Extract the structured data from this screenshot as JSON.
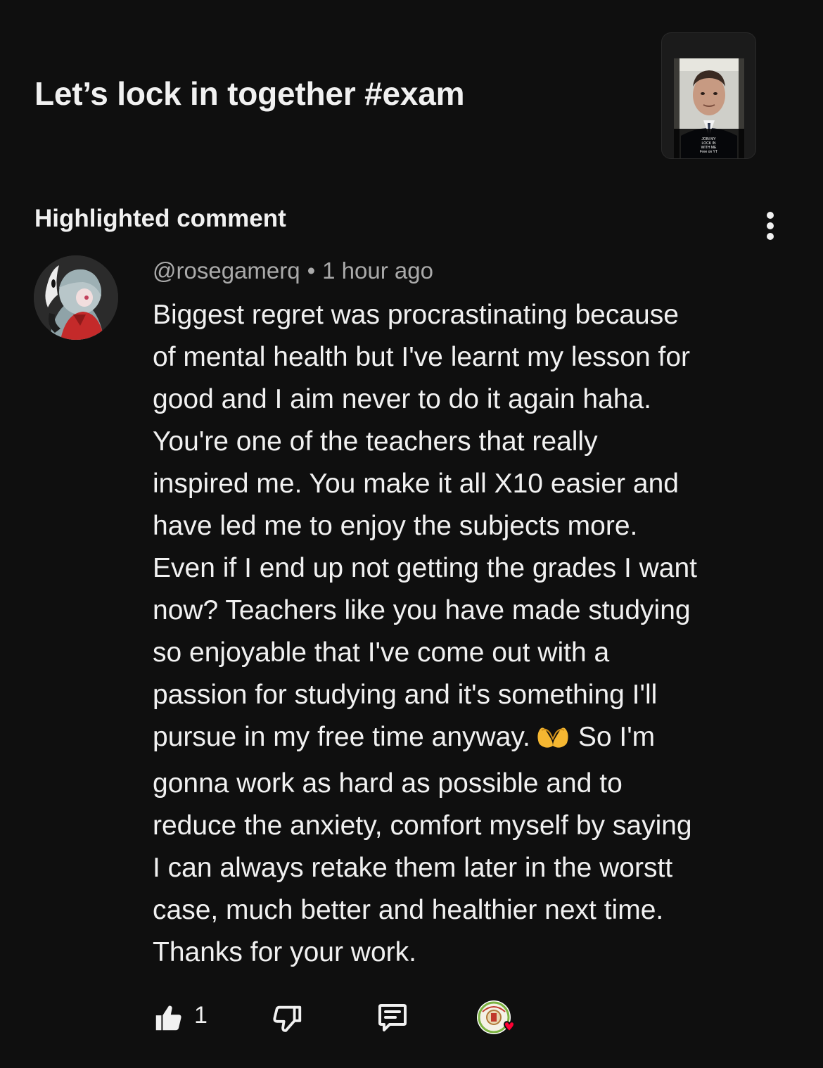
{
  "video": {
    "title": "Let’s lock in together #exam",
    "thumbnail_caption": "JOIN MY\nLOCK IN\nWITH ME\nFree on YT"
  },
  "section": {
    "heading": "Highlighted comment"
  },
  "comment": {
    "author": "@rosegamerq",
    "separator": "•",
    "time": "1 hour ago",
    "lines": [
      "Biggest regret was procrastinating because",
      "of mental health but I've learnt my lesson for",
      "good and I aim never to do it again haha.",
      "You're one of the teachers that really",
      "inspired me. You make it all X10 easier and",
      "have led me to enjoy the subjects more.",
      "Even if I end up not getting the grades I want",
      "now? Teachers like you have made studying",
      "so enjoyable that I've come out with a",
      "passion for studying and it's something I'll",
      "pursue in my free time anyway.",
      "So I'm",
      "gonna work as hard as possible and to",
      "reduce the anxiety, comfort myself by saying",
      "I can always retake them later in the worstt",
      "case, much better and healthier next time.",
      "Thanks for your work."
    ],
    "like_count": "1"
  },
  "icons": {
    "more": "more-vert-icon",
    "like": "thumbs-up-icon",
    "dislike": "thumbs-down-icon",
    "reply": "reply-comment-icon",
    "creator_heart": "creator-heart-badge",
    "emoji": "heart-hands-emoji"
  },
  "colors": {
    "background": "#0f0f0f",
    "text_primary": "#f1f1f1",
    "text_secondary": "#aaaaaa",
    "heart": "#ff0033"
  }
}
